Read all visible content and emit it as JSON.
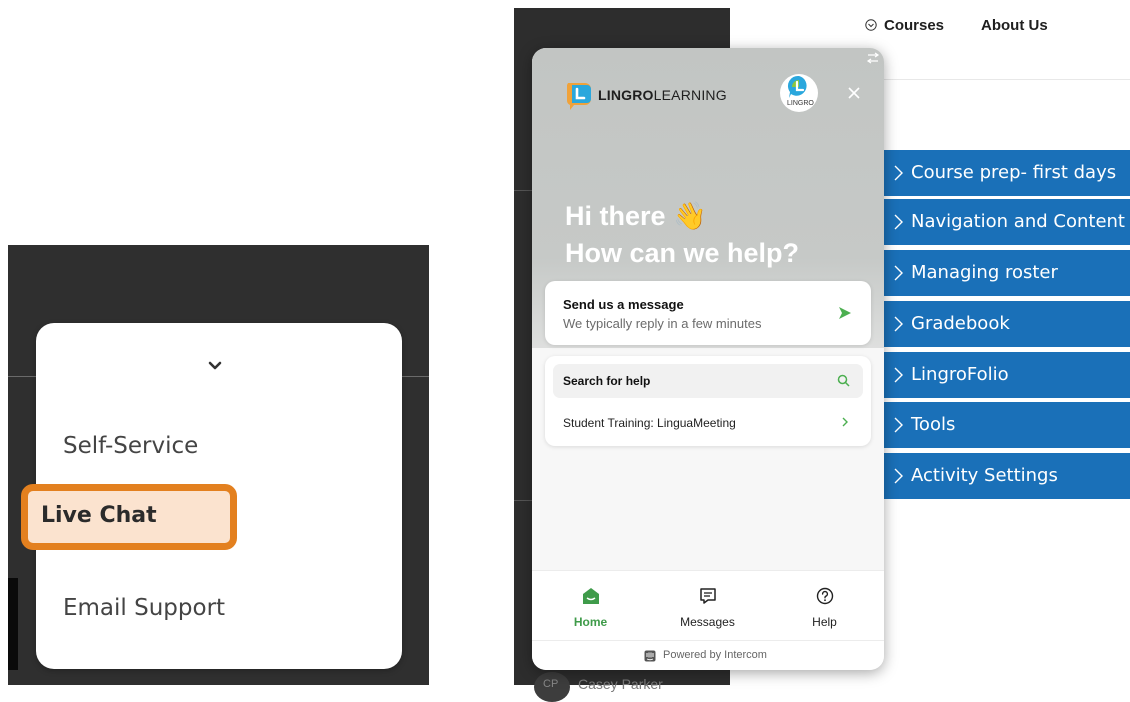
{
  "help_menu": {
    "items": [
      "Self-Service",
      "Live Chat",
      "Email Support"
    ],
    "highlighted": "Live Chat",
    "highlight_color": "#e3801f"
  },
  "page_nav": {
    "courses": "Courses",
    "about": "About Us",
    "courses_icon": "chevron-circle-icon"
  },
  "accordion": {
    "color": "#1a70b8",
    "items": [
      "Course prep- first days",
      "Navigation and Content",
      "Managing roster",
      "Gradebook",
      "LingroFolio",
      "Tools",
      "Activity Settings"
    ]
  },
  "sidebar": {
    "user_initials": "CP",
    "user_name": "Casey Parker"
  },
  "widget": {
    "logo_bold": "LINGRO",
    "logo_rest": "LEARNING",
    "avatar_text": "LINGRO",
    "greeting_line1": "Hi there 👋",
    "greeting_line2": "How can we help?",
    "message_card": {
      "title": "Send us a message",
      "subtitle": "We typically reply in a few minutes"
    },
    "search_label": "Search for help",
    "article": "Student Training: LinguaMeeting",
    "tabs": [
      {
        "label": "Home",
        "icon": "home-icon",
        "active": true
      },
      {
        "label": "Messages",
        "icon": "messages-icon",
        "active": false
      },
      {
        "label": "Help",
        "icon": "help-icon",
        "active": false
      }
    ],
    "powered_by": "Powered by Intercom",
    "accent": "#3f9b4a"
  }
}
